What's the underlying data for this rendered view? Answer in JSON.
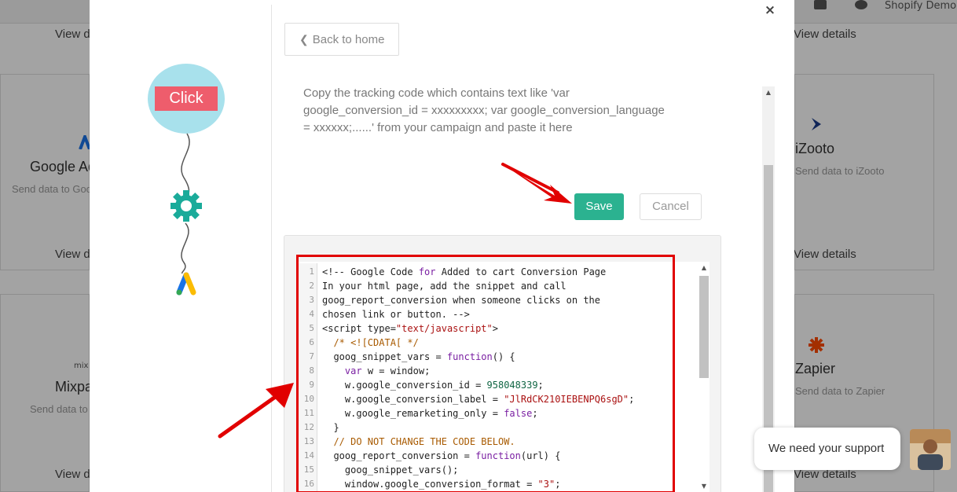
{
  "background": {
    "account_label": "Shopify Demo",
    "view_details": "View details",
    "cards": [
      {
        "name": "Google Ads",
        "sub": "Send data to Google Ads"
      },
      {
        "name": "iZooto",
        "sub": "Send data to iZooto"
      },
      {
        "name": "Mixpanel",
        "sub": "Send data to Mixpanel"
      },
      {
        "name": "Zapier",
        "sub": "Send data to Zapier"
      }
    ]
  },
  "modal": {
    "close_glyph": "×",
    "illustration_label": "Click",
    "back_button": "Back to home",
    "back_glyph": "❮",
    "instructions": "Copy the tracking code which contains text like 'var google_conversion_id = xxxxxxxxx; var google_conversion_language = xxxxxx;......' from your campaign and paste it here",
    "save_button": "Save",
    "cancel_button": "Cancel",
    "scroll_up_glyph": "▲",
    "scroll_down_glyph": "▼",
    "code_lines": [
      "<!-- Google Code for Added to cart Conversion Page",
      "In your html page, add the snippet and call",
      "goog_report_conversion when someone clicks on the",
      "chosen link or button. -->",
      "<script type=\"text/javascript\">",
      "  /* <![CDATA[ */",
      "  goog_snippet_vars = function() {",
      "    var w = window;",
      "    w.google_conversion_id = 958048339;",
      "    w.google_conversion_label = \"JlRdCK210IEBENPQ6sgD\";",
      "    w.google_remarketing_only = false;",
      "  }",
      "  // DO NOT CHANGE THE CODE BELOW.",
      "  goog_report_conversion = function(url) {",
      "    goog_snippet_vars();",
      "    window.google_conversion_format = \"3\";"
    ]
  },
  "support": {
    "label": "We need your support"
  },
  "colors": {
    "save": "#2bb290",
    "highlight": "#e10000",
    "balloon": "#a8e1ec",
    "badge": "#ee5d6c",
    "gear": "#1aab9a"
  }
}
